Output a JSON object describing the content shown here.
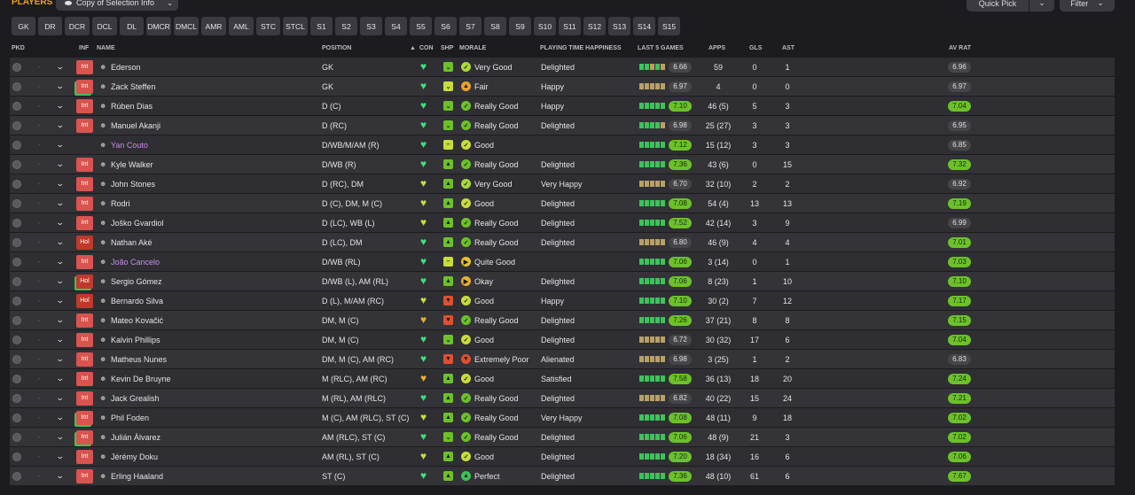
{
  "header": {
    "title": "PLAYERS",
    "view_label": "Copy of Selection Info",
    "quick_pick": "Quick Pick",
    "filter": "Filter"
  },
  "position_filters": [
    "GK",
    "DR",
    "DCR",
    "DCL",
    "DL",
    "DMCR",
    "DMCL",
    "AMR",
    "AML",
    "STC",
    "STCL",
    "S1",
    "S2",
    "S3",
    "S4",
    "S5",
    "S6",
    "S7",
    "S8",
    "S9",
    "S10",
    "S11",
    "S12",
    "S13",
    "S14",
    "S15"
  ],
  "columns": {
    "pkd": "PKD",
    "inf": "INF",
    "name": "NAME",
    "position": "POSITION",
    "con": "CON",
    "shp": "SHP",
    "morale": "MORALE",
    "pth": "PLAYING TIME HAPPINESS",
    "last5": "LAST 5 GAMES",
    "apps": "APPS",
    "gls": "GLS",
    "ast": "AST",
    "avrat": "AV RAT"
  },
  "colors": {
    "accent": "#f0a020",
    "green": "#6cc12a",
    "form_green": "#3cc35a",
    "form_tan": "#b8a066",
    "inf_red": "#d9534f",
    "loan_name": "#c890e8"
  },
  "players": [
    {
      "inf": "Int",
      "inf_green": false,
      "name": "Ederson",
      "loan": false,
      "position": "GK",
      "con": "green",
      "shp": "green",
      "shp_icon": "chevron-down",
      "morale_icon": "check",
      "morale_color": "#a8d83c",
      "morale": "Very Good",
      "pth": "Delighted",
      "form": [
        "g",
        "g",
        "t",
        "g",
        "t"
      ],
      "last5": "6.66",
      "l5_green": false,
      "apps": "59",
      "gls": "0",
      "ast": "1",
      "avrat": "6.96",
      "av_green": false
    },
    {
      "inf": "Int",
      "inf_green": true,
      "name": "Zack Steffen",
      "loan": false,
      "position": "GK",
      "con": "green",
      "shp": "yellow",
      "shp_icon": "chevron-down",
      "morale_icon": "up",
      "morale_color": "#e8a030",
      "morale": "Fair",
      "pth": "Happy",
      "form": [
        "t",
        "t",
        "t",
        "t",
        "t"
      ],
      "last5": "6.97",
      "l5_green": false,
      "apps": "4",
      "gls": "0",
      "ast": "0",
      "avrat": "6.97",
      "av_green": false
    },
    {
      "inf": "Int",
      "inf_green": false,
      "name": "Rúben Dias",
      "loan": false,
      "position": "D (C)",
      "con": "green",
      "shp": "green",
      "shp_icon": "chevron-down",
      "morale_icon": "check",
      "morale_color": "#6cc12a",
      "morale": "Really Good",
      "pth": "Happy",
      "form": [
        "g",
        "g",
        "g",
        "g",
        "g"
      ],
      "last5": "7.10",
      "l5_green": true,
      "apps": "46 (5)",
      "gls": "5",
      "ast": "3",
      "avrat": "7.04",
      "av_green": true
    },
    {
      "inf": "Int",
      "inf_green": false,
      "name": "Manuel Akanji",
      "loan": false,
      "position": "D (RC)",
      "con": "green",
      "shp": "green",
      "shp_icon": "chevron-down",
      "morale_icon": "check",
      "morale_color": "#6cc12a",
      "morale": "Really Good",
      "pth": "Delighted",
      "form": [
        "g",
        "g",
        "g",
        "g",
        "t"
      ],
      "last5": "6.98",
      "l5_green": false,
      "apps": "25 (27)",
      "gls": "3",
      "ast": "3",
      "avrat": "6.95",
      "av_green": false
    },
    {
      "inf": "",
      "inf_green": false,
      "name": "Yan Couto",
      "loan": true,
      "position": "D/WB/M/AM (R)",
      "con": "green",
      "shp": "yellow",
      "shp_icon": "minus",
      "morale_icon": "check",
      "morale_color": "#c8dc3c",
      "morale": "Good",
      "pth": "",
      "form": [
        "g",
        "g",
        "g",
        "g",
        "g"
      ],
      "last5": "7.12",
      "l5_green": true,
      "apps": "15 (12)",
      "gls": "3",
      "ast": "3",
      "avrat": "6.85",
      "av_green": false
    },
    {
      "inf": "Int",
      "inf_green": false,
      "name": "Kyle Walker",
      "loan": false,
      "position": "D/WB (R)",
      "con": "green",
      "shp": "green",
      "shp_icon": "up",
      "morale_icon": "check",
      "morale_color": "#6cc12a",
      "morale": "Really Good",
      "pth": "Delighted",
      "form": [
        "g",
        "g",
        "g",
        "g",
        "g"
      ],
      "last5": "7.36",
      "l5_green": true,
      "apps": "43 (6)",
      "gls": "0",
      "ast": "15",
      "avrat": "7.32",
      "av_green": true
    },
    {
      "inf": "Int",
      "inf_green": false,
      "name": "John Stones",
      "loan": false,
      "position": "D (RC), DM",
      "con": "yellow",
      "shp": "green",
      "shp_icon": "up",
      "morale_icon": "check",
      "morale_color": "#a8d83c",
      "morale": "Very Good",
      "pth": "Very Happy",
      "form": [
        "t",
        "t",
        "t",
        "t",
        "t"
      ],
      "last5": "6.70",
      "l5_green": false,
      "apps": "32 (10)",
      "gls": "2",
      "ast": "2",
      "avrat": "6.92",
      "av_green": false
    },
    {
      "inf": "Int",
      "inf_green": false,
      "name": "Rodri",
      "loan": false,
      "position": "D (C), DM, M (C)",
      "con": "yellow",
      "shp": "green",
      "shp_icon": "up",
      "morale_icon": "check",
      "morale_color": "#c8dc3c",
      "morale": "Good",
      "pth": "Delighted",
      "form": [
        "g",
        "g",
        "g",
        "g",
        "g"
      ],
      "last5": "7.08",
      "l5_green": true,
      "apps": "54 (4)",
      "gls": "13",
      "ast": "13",
      "avrat": "7.19",
      "av_green": true
    },
    {
      "inf": "Int",
      "inf_green": false,
      "name": "Joško Gvardiol",
      "loan": false,
      "position": "D (LC), WB (L)",
      "con": "yellow",
      "shp": "green",
      "shp_icon": "up",
      "morale_icon": "check",
      "morale_color": "#6cc12a",
      "morale": "Really Good",
      "pth": "Delighted",
      "form": [
        "g",
        "g",
        "g",
        "g",
        "g"
      ],
      "last5": "7.52",
      "l5_green": true,
      "apps": "42 (14)",
      "gls": "3",
      "ast": "9",
      "avrat": "6.99",
      "av_green": false
    },
    {
      "inf": "Hol",
      "inf_green": false,
      "name": "Nathan Aké",
      "loan": false,
      "position": "D (LC), DM",
      "con": "green",
      "shp": "green",
      "shp_icon": "up",
      "morale_icon": "check",
      "morale_color": "#6cc12a",
      "morale": "Really Good",
      "pth": "Delighted",
      "form": [
        "t",
        "t",
        "t",
        "t",
        "t"
      ],
      "last5": "6.80",
      "l5_green": false,
      "apps": "46 (9)",
      "gls": "4",
      "ast": "4",
      "avrat": "7.01",
      "av_green": true
    },
    {
      "inf": "Int",
      "inf_green": false,
      "name": "João Cancelo",
      "loan": true,
      "position": "D/WB (RL)",
      "con": "green",
      "shp": "yellow",
      "shp_icon": "minus",
      "morale_icon": "right",
      "morale_color": "#e8c030",
      "morale": "Quite Good",
      "pth": "",
      "form": [
        "g",
        "g",
        "g",
        "g",
        "g"
      ],
      "last5": "7.06",
      "l5_green": true,
      "apps": "3 (14)",
      "gls": "0",
      "ast": "1",
      "avrat": "7.03",
      "av_green": true
    },
    {
      "inf": "Hol",
      "inf_green": true,
      "name": "Sergio Gómez",
      "loan": false,
      "position": "D/WB (L), AM (RL)",
      "con": "green",
      "shp": "green",
      "shp_icon": "up",
      "morale_icon": "right",
      "morale_color": "#e8b030",
      "morale": "Okay",
      "pth": "Delighted",
      "form": [
        "g",
        "g",
        "g",
        "g",
        "g"
      ],
      "last5": "7.06",
      "l5_green": true,
      "apps": "8 (23)",
      "gls": "1",
      "ast": "10",
      "avrat": "7.10",
      "av_green": true
    },
    {
      "inf": "Hol",
      "inf_green": false,
      "name": "Bernardo Silva",
      "loan": false,
      "position": "D (L), M/AM (RC)",
      "con": "yellow",
      "shp": "red",
      "shp_icon": "down",
      "morale_icon": "check",
      "morale_color": "#c8dc3c",
      "morale": "Good",
      "pth": "Happy",
      "form": [
        "g",
        "g",
        "g",
        "g",
        "g"
      ],
      "last5": "7.10",
      "l5_green": true,
      "apps": "30 (2)",
      "gls": "7",
      "ast": "12",
      "avrat": "7.17",
      "av_green": true
    },
    {
      "inf": "Int",
      "inf_green": false,
      "name": "Mateo Kovačić",
      "loan": false,
      "position": "DM, M (C)",
      "con": "orange",
      "shp": "red",
      "shp_icon": "down",
      "morale_icon": "check",
      "morale_color": "#6cc12a",
      "morale": "Really Good",
      "pth": "Delighted",
      "form": [
        "g",
        "g",
        "g",
        "g",
        "g"
      ],
      "last5": "7.26",
      "l5_green": true,
      "apps": "37 (21)",
      "gls": "8",
      "ast": "8",
      "avrat": "7.15",
      "av_green": true
    },
    {
      "inf": "Int",
      "inf_green": false,
      "name": "Kalvin Phillips",
      "loan": false,
      "position": "DM, M (C)",
      "con": "green",
      "shp": "green",
      "shp_icon": "chevron-down",
      "morale_icon": "check",
      "morale_color": "#c8dc3c",
      "morale": "Good",
      "pth": "Delighted",
      "form": [
        "t",
        "t",
        "t",
        "t",
        "t"
      ],
      "last5": "6.72",
      "l5_green": false,
      "apps": "30 (32)",
      "gls": "17",
      "ast": "6",
      "avrat": "7.04",
      "av_green": true
    },
    {
      "inf": "Int",
      "inf_green": false,
      "name": "Matheus Nunes",
      "loan": false,
      "position": "DM, M (C), AM (RC)",
      "con": "green",
      "shp": "red",
      "shp_icon": "down",
      "morale_icon": "down",
      "morale_color": "#e05030",
      "morale": "Extremely Poor",
      "pth": "Alienated",
      "form": [
        "t",
        "t",
        "t",
        "t",
        "t"
      ],
      "last5": "6.98",
      "l5_green": false,
      "apps": "3 (25)",
      "gls": "1",
      "ast": "2",
      "avrat": "6.83",
      "av_green": false
    },
    {
      "inf": "Int",
      "inf_green": false,
      "name": "Kevin De Bruyne",
      "loan": false,
      "position": "M (RLC), AM (RC)",
      "con": "orange",
      "shp": "green",
      "shp_icon": "up",
      "morale_icon": "check",
      "morale_color": "#c8dc3c",
      "morale": "Good",
      "pth": "Satisfied",
      "form": [
        "g",
        "g",
        "g",
        "g",
        "g"
      ],
      "last5": "7.58",
      "l5_green": true,
      "apps": "36 (13)",
      "gls": "18",
      "ast": "20",
      "avrat": "7.24",
      "av_green": true
    },
    {
      "inf": "Int",
      "inf_green": false,
      "name": "Jack Grealish",
      "loan": false,
      "position": "M (RL), AM (RLC)",
      "con": "green",
      "shp": "green",
      "shp_icon": "up",
      "morale_icon": "check",
      "morale_color": "#6cc12a",
      "morale": "Really Good",
      "pth": "Delighted",
      "form": [
        "t",
        "t",
        "t",
        "t",
        "t"
      ],
      "last5": "6.82",
      "l5_green": false,
      "apps": "40 (22)",
      "gls": "15",
      "ast": "24",
      "avrat": "7.21",
      "av_green": true
    },
    {
      "inf": "Int",
      "inf_green": true,
      "name": "Phil Foden",
      "loan": false,
      "position": "M (C), AM (RLC), ST (C)",
      "con": "yellow",
      "shp": "green",
      "shp_icon": "up",
      "morale_icon": "check",
      "morale_color": "#6cc12a",
      "morale": "Really Good",
      "pth": "Very Happy",
      "form": [
        "g",
        "g",
        "g",
        "g",
        "g"
      ],
      "last5": "7.08",
      "l5_green": true,
      "apps": "48 (11)",
      "gls": "9",
      "ast": "18",
      "avrat": "7.02",
      "av_green": true
    },
    {
      "inf": "Int",
      "inf_green": true,
      "name": "Julián Álvarez",
      "loan": false,
      "position": "AM (RLC), ST (C)",
      "con": "green",
      "shp": "green",
      "shp_icon": "chevron-down",
      "morale_icon": "check",
      "morale_color": "#6cc12a",
      "morale": "Really Good",
      "pth": "Delighted",
      "form": [
        "g",
        "g",
        "g",
        "g",
        "g"
      ],
      "last5": "7.06",
      "l5_green": true,
      "apps": "48 (9)",
      "gls": "21",
      "ast": "3",
      "avrat": "7.02",
      "av_green": true
    },
    {
      "inf": "Int",
      "inf_green": false,
      "name": "Jérémy Doku",
      "loan": false,
      "position": "AM (RL), ST (C)",
      "con": "yellow",
      "shp": "green",
      "shp_icon": "up",
      "morale_icon": "check",
      "morale_color": "#c8dc3c",
      "morale": "Good",
      "pth": "Delighted",
      "form": [
        "g",
        "g",
        "g",
        "g",
        "g"
      ],
      "last5": "7.20",
      "l5_green": true,
      "apps": "18 (34)",
      "gls": "16",
      "ast": "6",
      "avrat": "7.06",
      "av_green": true
    },
    {
      "inf": "Int",
      "inf_green": false,
      "name": "Erling Haaland",
      "loan": false,
      "position": "ST (C)",
      "con": "green",
      "shp": "green",
      "shp_icon": "up",
      "morale_icon": "up",
      "morale_color": "#3cc35a",
      "morale": "Perfect",
      "pth": "Delighted",
      "form": [
        "g",
        "g",
        "g",
        "g",
        "g"
      ],
      "last5": "7.36",
      "l5_green": true,
      "apps": "48 (10)",
      "gls": "61",
      "ast": "6",
      "avrat": "7.67",
      "av_green": true
    }
  ]
}
